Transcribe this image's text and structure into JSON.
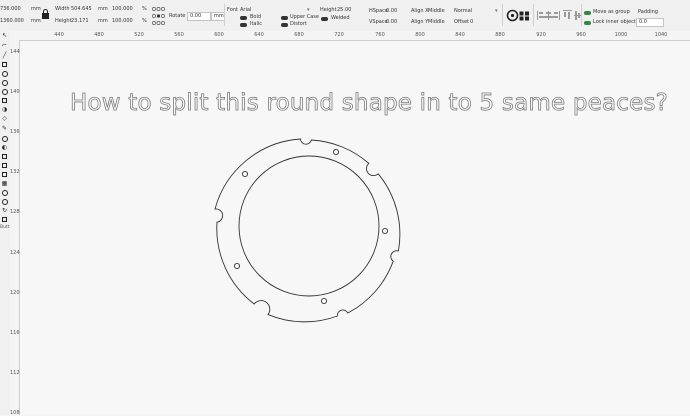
{
  "toolbar": {
    "x_value": "736.000",
    "y_value": "1360.000",
    "unit": "mm",
    "width_label": "Width",
    "width_value": "504.645",
    "height_label": "Height",
    "height_value": "23.171",
    "scale_w_value": "100.000",
    "scale_h_value": "100.000",
    "percent": "%",
    "rotate_label": "Rotate",
    "rotate_value": "0.00",
    "font_label": "Font",
    "font_value": "Arial",
    "bold_label": "Bold",
    "italic_label": "Italic",
    "upper_case_label": "Upper Case",
    "distort_label": "Distort",
    "welded_label": "Welded",
    "text_height_label": "Height",
    "text_height_value": "25.00",
    "hspace_label": "HSpace",
    "hspace_value": "0.00",
    "vspace_label": "VSpace",
    "vspace_value": "0.00",
    "align_x_label": "Align X",
    "align_x_value": "Middle",
    "align_y_label": "Align Y",
    "align_y_value": "Middle",
    "normal_value": "Normal",
    "offset_label": "Offset",
    "offset_value": "0",
    "move_as_group_label": "Move as group",
    "lock_inner_label": "Lock inner objects",
    "padding_label": "Padding",
    "padding_value": "0.0"
  },
  "rulers": {
    "h_labels": [
      "440",
      "480",
      "520",
      "560",
      "600",
      "640",
      "680",
      "720",
      "760",
      "800",
      "840",
      "880",
      "920",
      "960",
      "1000",
      "1040"
    ],
    "v_labels": [
      "1440",
      "1400",
      "1360",
      "1320",
      "1280",
      "1240",
      "1200",
      "1160",
      "1120",
      "1080"
    ]
  },
  "tools": {
    "button_label": "Butt"
  },
  "canvas": {
    "question_text": "How to split this round shape in to 5 same peaces?"
  },
  "colors": {
    "toggle_on": "#2e8b3a",
    "toggle_off": "#333333",
    "canvas_bg": "#f7f7f7",
    "outline": "#333333"
  }
}
